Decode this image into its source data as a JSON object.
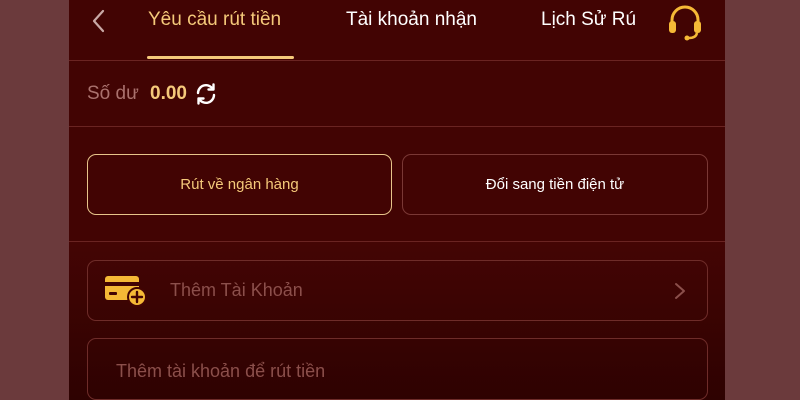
{
  "header": {
    "tabs": [
      {
        "label": "Yêu cầu rút tiền",
        "active": true
      },
      {
        "label": "Tài khoản nhận",
        "active": false
      },
      {
        "label": "Lịch Sử Rú",
        "active": false
      }
    ],
    "back_icon": "chevron-left-icon",
    "support_icon": "headset-icon"
  },
  "balance": {
    "label": "Số dư",
    "value": "0.00",
    "refresh_icon": "refresh-icon"
  },
  "methods": [
    {
      "label": "Rút về ngân hàng",
      "selected": true
    },
    {
      "label": "Đổi sang tiền điện tử",
      "selected": false
    }
  ],
  "add_account": {
    "label": "Thêm Tài Khoản",
    "icon": "card-add-icon"
  },
  "hint": {
    "text": "Thêm tài khoản để rút tiền"
  },
  "colors": {
    "background": "#420403",
    "accent": "#f5c97a",
    "outer": "#6b3a3c"
  }
}
